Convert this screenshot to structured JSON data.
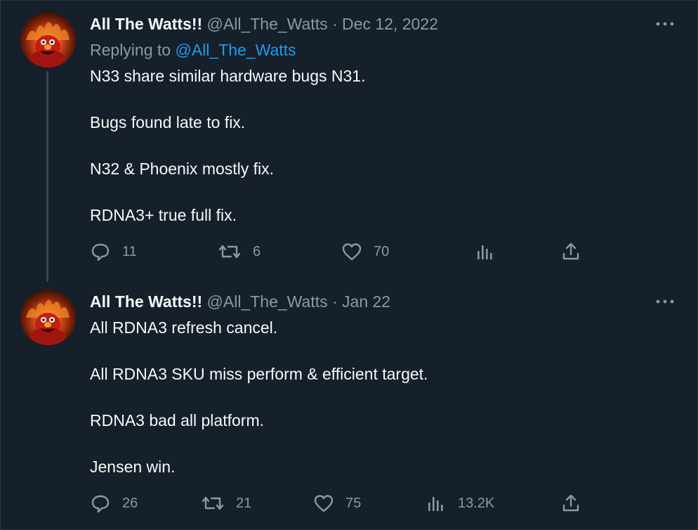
{
  "tweets": [
    {
      "display_name": "All The Watts!!",
      "handle": "@All_The_Watts",
      "separator": "·",
      "date": "Dec 12, 2022",
      "replying_prefix": "Replying to",
      "replying_to": "@All_The_Watts",
      "lines": [
        "N33 share similar hardware bugs N31.",
        "Bugs found late to fix.",
        "N32 & Phoenix mostly fix.",
        "RDNA3+ true full fix."
      ],
      "actions": {
        "replies": "11",
        "retweets": "6",
        "likes": "70",
        "views": ""
      }
    },
    {
      "display_name": "All The Watts!!",
      "handle": "@All_The_Watts",
      "separator": "·",
      "date": "Jan 22",
      "lines": [
        "All RDNA3 refresh cancel.",
        "All RDNA3 SKU miss perform & efficient target.",
        "RDNA3 bad all platform.",
        "Jensen win."
      ],
      "actions": {
        "replies": "26",
        "retweets": "21",
        "likes": "75",
        "views": "13.2K"
      }
    }
  ],
  "icons": {
    "avatar": "flaming-elmo-avatar",
    "more": "more-dots-icon",
    "reply": "reply-bubble-icon",
    "retweet": "retweet-icon",
    "like": "heart-icon",
    "views": "views-bars-icon",
    "share": "share-upload-icon"
  },
  "colors": {
    "background": "#15202b",
    "text": "#f7f9f9",
    "muted": "#8b98a5",
    "link": "#1d9bf0",
    "thread_line": "#38444d"
  }
}
